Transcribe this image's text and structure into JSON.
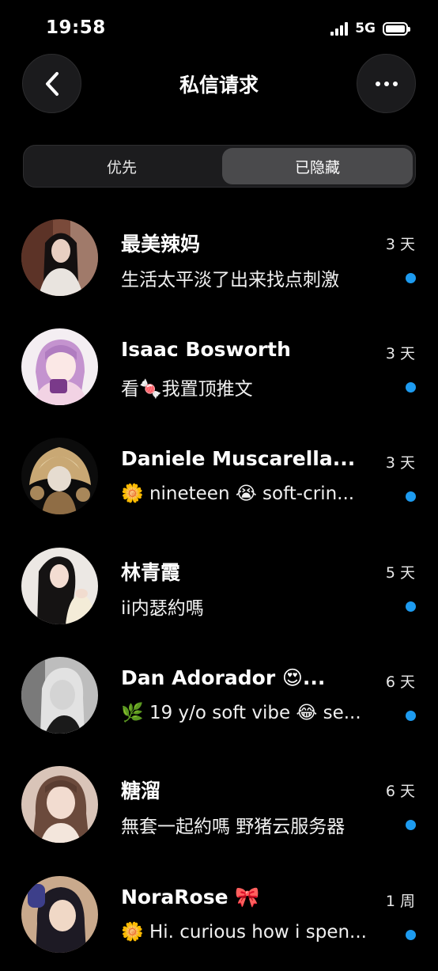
{
  "status_bar": {
    "time": "19:58",
    "network": "5G",
    "battery_level": 1.0
  },
  "header": {
    "title": "私信请求",
    "back_icon": "chevron-left-icon",
    "more_icon": "more-horizontal-icon"
  },
  "tabs": [
    {
      "label": "优先",
      "selected": false
    },
    {
      "label": "已隐藏",
      "selected": true
    }
  ],
  "conversations": [
    {
      "name": "最美辣妈",
      "preview": "生活太平淡了出来找点刺激",
      "time": "3 天",
      "unread": true
    },
    {
      "name": "Isaac Bosworth",
      "preview": "看🍬我置顶推文",
      "time": "3 天",
      "unread": true
    },
    {
      "name": "Daniele Muscarella...",
      "preview": "🌼 nineteen 😭 soft-crin...",
      "time": "3 天",
      "unread": true
    },
    {
      "name": "林青霞",
      "preview": "ii内瑟約嗎",
      "time": "5 天",
      "unread": true
    },
    {
      "name": "Dan Adorador 😍...",
      "preview": "🌿 19 y/o soft vibe 😂 se...",
      "time": "6 天",
      "unread": true
    },
    {
      "name": "糖溜",
      "preview": "無套一起約嗎 野猪云服务器",
      "time": "6 天",
      "unread": true
    },
    {
      "name": "NoraRose 🎀",
      "preview": "🌼 Hi. curious how i spen...",
      "time": "1 周",
      "unread": true
    }
  ],
  "colors": {
    "background": "#000000",
    "unread_dot": "#1d9bf0",
    "segment_selected": "#4a4a4c"
  }
}
